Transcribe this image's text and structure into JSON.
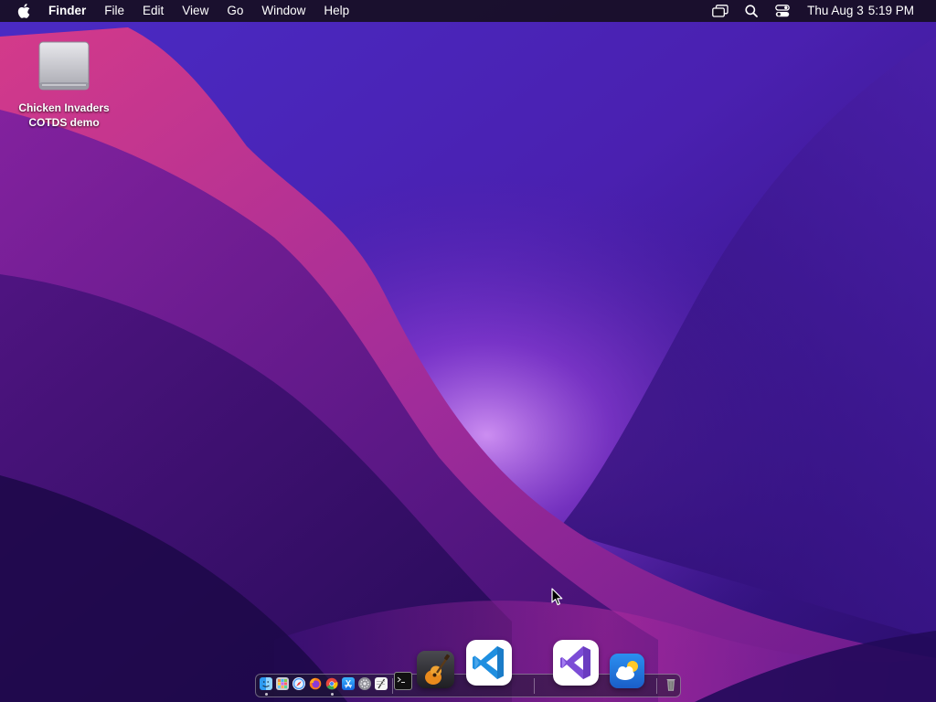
{
  "menubar": {
    "apple_icon": "apple-logo-icon",
    "app_name": "Finder",
    "menus": [
      "File",
      "Edit",
      "View",
      "Go",
      "Window",
      "Help"
    ],
    "status_icons": [
      "screen-mirroring-icon",
      "spotlight-search-icon",
      "control-center-icon"
    ],
    "clock": {
      "date": "Thu Aug 3",
      "time": "5:19 PM"
    }
  },
  "desktop": {
    "items": [
      {
        "icon": "external-drive-icon",
        "label_line1": "Chicken Invaders",
        "label_line2": "COTDS demo"
      }
    ]
  },
  "dock": {
    "apps": [
      {
        "name": "Finder",
        "icon": "finder-icon",
        "running": true
      },
      {
        "name": "Launchpad",
        "icon": "launchpad-icon",
        "running": false
      },
      {
        "name": "Safari",
        "icon": "safari-icon",
        "running": false
      },
      {
        "name": "Firefox",
        "icon": "firefox-icon",
        "running": false
      },
      {
        "name": "Chrome",
        "icon": "chrome-icon",
        "running": true
      },
      {
        "name": "App Store",
        "icon": "app-store-icon",
        "running": false
      },
      {
        "name": "System Preferences",
        "icon": "system-preferences-icon",
        "running": false
      },
      {
        "name": "TextEdit",
        "icon": "textedit-icon",
        "running": false
      },
      {
        "name": "Terminal",
        "icon": "terminal-icon",
        "running": false
      },
      {
        "name": "GarageBand",
        "icon": "garageband-icon",
        "running": false
      },
      {
        "name": "Visual Studio Code",
        "icon": "vscode-icon",
        "running": false
      },
      {
        "name": "Visual Studio",
        "icon": "visual-studio-icon",
        "running": false
      },
      {
        "name": "Weather",
        "icon": "weather-icon",
        "running": false
      },
      {
        "name": "Trash",
        "icon": "trash-icon",
        "running": false
      }
    ]
  },
  "colors": {
    "menubar_bg": "#160e22",
    "vscode_blue": "#1f8fe0",
    "visual_studio_purple": "#7c4dd6",
    "wallpaper_pink": "#d0369b",
    "wallpaper_violet": "#5a1fb8"
  }
}
